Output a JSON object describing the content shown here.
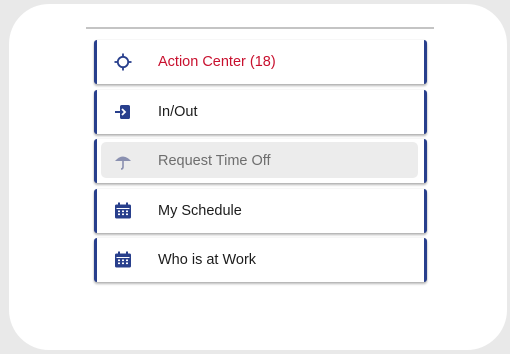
{
  "colors": {
    "accent": "#283f8c",
    "alert_text": "#c8102e",
    "disabled_bg": "#ececec",
    "muted_text": "#6e6e6e",
    "disabled_icon": "#8a90b0"
  },
  "menu": {
    "items": [
      {
        "label": "Action Center (18)",
        "icon": "crosshair-icon",
        "state": "alert"
      },
      {
        "label": "In/Out",
        "icon": "sign-in-icon",
        "state": "normal"
      },
      {
        "label": "Request Time Off",
        "icon": "umbrella-icon",
        "state": "disabled"
      },
      {
        "label": "My Schedule",
        "icon": "calendar-icon",
        "state": "normal"
      },
      {
        "label": "Who is at Work",
        "icon": "calendar-icon",
        "state": "normal"
      }
    ]
  }
}
